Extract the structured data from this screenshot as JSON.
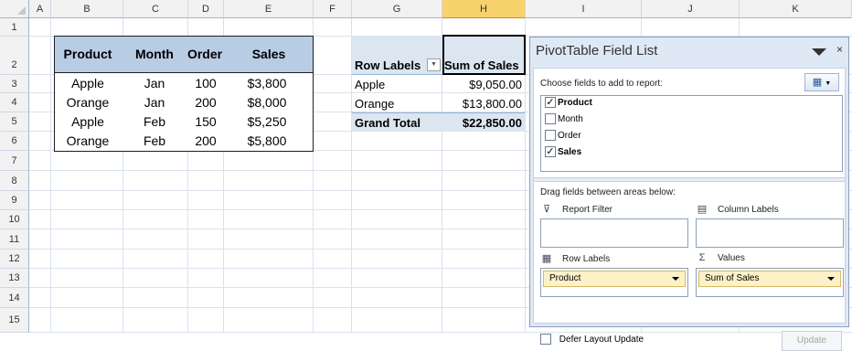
{
  "columns": [
    "A",
    "B",
    "C",
    "D",
    "E",
    "F",
    "G",
    "H",
    "I",
    "J",
    "K"
  ],
  "selected_column": "H",
  "rows": [
    "1",
    "2",
    "3",
    "4",
    "5",
    "6",
    "7",
    "8",
    "9",
    "10",
    "11",
    "12",
    "13",
    "14",
    "15"
  ],
  "source_table": {
    "headers": [
      "Product",
      "Month",
      "Order",
      "Sales"
    ],
    "rows": [
      [
        "Apple",
        "Jan",
        "100",
        "$3,800"
      ],
      [
        "Orange",
        "Jan",
        "200",
        "$8,000"
      ],
      [
        "Apple",
        "Feb",
        "150",
        "$5,250"
      ],
      [
        "Orange",
        "Feb",
        "200",
        "$5,800"
      ]
    ]
  },
  "pivot": {
    "row_labels_header": "Row Labels",
    "value_header": "Sum of Sales",
    "rows": [
      {
        "label": "Apple",
        "value": "$9,050.00"
      },
      {
        "label": "Orange",
        "value": "$13,800.00"
      }
    ],
    "total_label": "Grand Total",
    "total_value": "$22,850.00"
  },
  "field_list": {
    "title": "PivotTable Field List",
    "close_glyph": "×",
    "choose_label": "Choose fields to add to report:",
    "fields": [
      {
        "name": "Product",
        "checked": true
      },
      {
        "name": "Month",
        "checked": false
      },
      {
        "name": "Order",
        "checked": false
      },
      {
        "name": "Sales",
        "checked": true
      }
    ],
    "drag_label": "Drag fields between areas below:",
    "report_filter_label": "Report Filter",
    "column_labels_label": "Column Labels",
    "row_labels_label": "Row Labels",
    "values_label": "Values",
    "row_labels_chip": "Product",
    "values_chip": "Sum of Sales",
    "defer_label": "Defer Layout Update",
    "update_label": "Update",
    "check_glyph": "✓"
  },
  "colors": {
    "table_header": "#b8cce4",
    "pivot_header": "#dce6f1",
    "pane_bg": "#dfe8f5",
    "chip_bg": "#fdf1c8",
    "selected_column_header": "#f8d26c"
  }
}
